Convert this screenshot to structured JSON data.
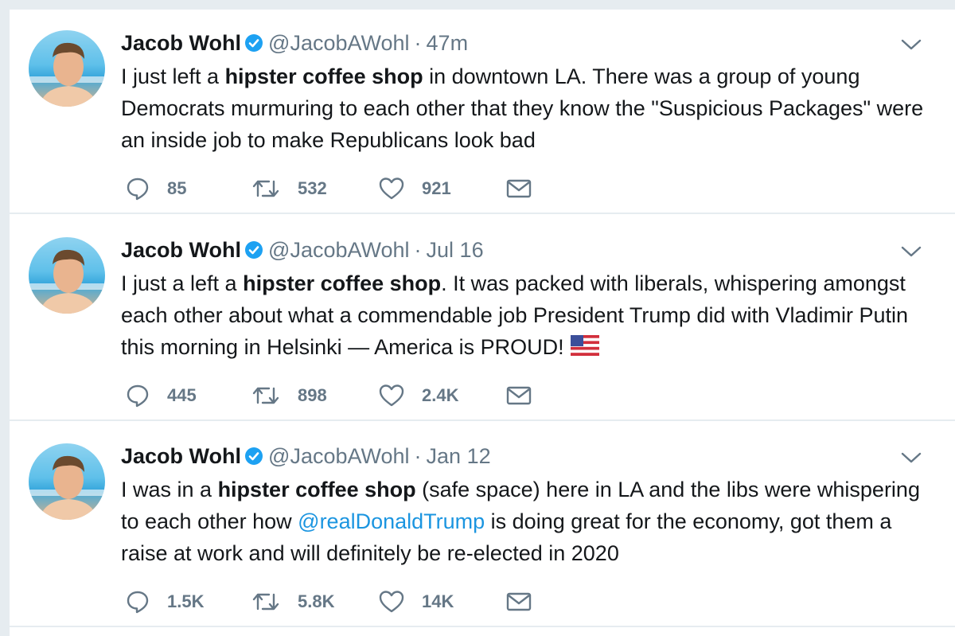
{
  "colors": {
    "name": "#14171a",
    "muted": "#657786",
    "link": "#1b95e0",
    "verified": "#1da1f2",
    "divider": "#e6ecf0"
  },
  "tweets": [
    {
      "author": "Jacob Wohl",
      "handle": "@JacobAWohl",
      "separator": "·",
      "time": "47m",
      "text": {
        "p1": "I just left a ",
        "b1": "hipster coffee shop",
        "p2": " in downtown LA. There was a group of young Democrats murmuring to each other that they know the \"Suspicious Packages\" were an inside job to make Republicans look bad"
      },
      "replies": "85",
      "retweets": "532",
      "likes": "921"
    },
    {
      "author": "Jacob Wohl",
      "handle": "@JacobAWohl",
      "separator": "·",
      "time": "Jul 16",
      "text": {
        "p1": "I just a left a ",
        "b1": "hipster coffee shop",
        "p2": ". It was packed with liberals, whispering amongst each other about what a commendable job President Trump did with Vladimir Putin this morning in Helsinki — America is PROUD!"
      },
      "replies": "445",
      "retweets": "898",
      "likes": "2.4K"
    },
    {
      "author": "Jacob Wohl",
      "handle": "@JacobAWohl",
      "separator": "·",
      "time": "Jan 12",
      "text": {
        "p1": "I was in a ",
        "b1": "hipster coffee shop",
        "p2": " (safe space) here in LA and the libs were whispering to each other how ",
        "mention": "@realDonaldTrump",
        "p3": " is doing great for the economy, got them a raise at work and will definitely be re-elected in 2020"
      },
      "replies": "1.5K",
      "retweets": "5.8K",
      "likes": "14K"
    }
  ],
  "icons": [
    "avatar-photo",
    "verified-badge-icon",
    "chevron-down-icon",
    "reply-icon",
    "retweet-icon",
    "like-heart-icon",
    "direct-message-icon",
    "us-flag-emoji"
  ]
}
